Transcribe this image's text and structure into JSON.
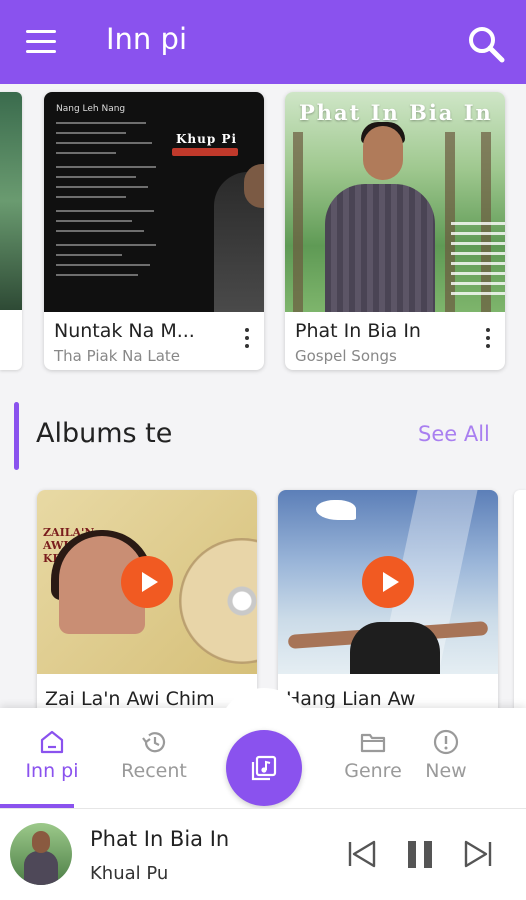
{
  "app": {
    "title": "Inn pi",
    "accent": "#8a52ee"
  },
  "songs": [
    {
      "title": "Nuntak Na M...",
      "subtitle": "Tha Piak Na Late",
      "cover_heading": "Nang Leh Nang",
      "cover_artist": "Khup Pi"
    },
    {
      "title": "Phat In Bia In",
      "subtitle": "Gospel Songs",
      "cover_heading": "Phat In Bia In"
    }
  ],
  "section": {
    "title": "Albums te",
    "see_all": "See All"
  },
  "albums": [
    {
      "title": "Zai La'n Awi Chim",
      "cover_text": "ZAILA'N AWI CHIM KEI NING"
    },
    {
      "title": "Hang Lian Aw"
    }
  ],
  "nav": {
    "items": [
      {
        "label": "Inn pi",
        "icon": "home-icon",
        "active": true
      },
      {
        "label": "Recent",
        "icon": "history-icon",
        "active": false
      },
      {
        "label": "Genre",
        "icon": "folder-icon",
        "active": false
      },
      {
        "label": "New",
        "icon": "alert-circle-icon",
        "active": false
      }
    ],
    "center_icon": "music-library-icon"
  },
  "player": {
    "title": "Phat In Bia In",
    "artist": "Khual Pu"
  }
}
